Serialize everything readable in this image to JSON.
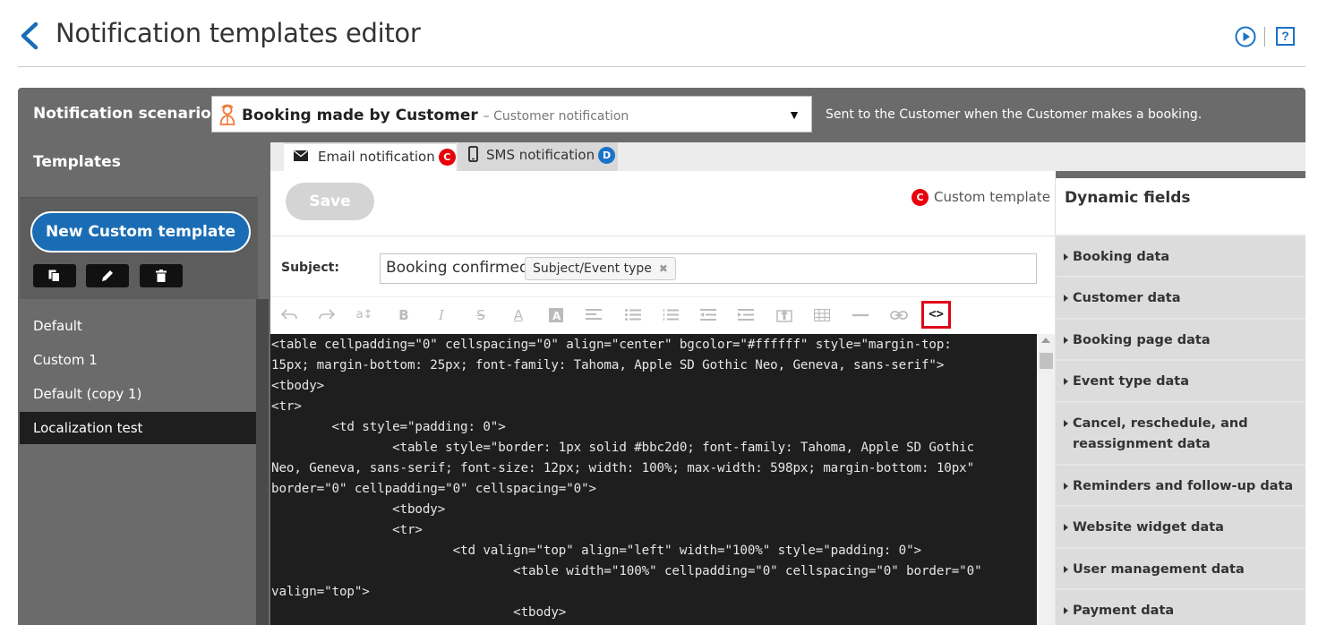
{
  "header": {
    "title": "Notification templates editor",
    "help_label": "?"
  },
  "scenario": {
    "label": "Notification scenario:",
    "selected_main": "Booking made by Customer",
    "selected_sub": "– Customer notification",
    "description": "Sent to the Customer when the Customer makes a booking."
  },
  "sidebar": {
    "title": "Templates",
    "new_button": "New Custom template",
    "items": [
      {
        "label": "Default",
        "active": false
      },
      {
        "label": "Custom 1",
        "active": false
      },
      {
        "label": "Default (copy 1)",
        "active": false
      },
      {
        "label": "Localization test",
        "active": true
      }
    ]
  },
  "tabs": [
    {
      "label": "Email notification",
      "badge": "C",
      "active": true
    },
    {
      "label": "SMS notification",
      "badge": "D",
      "active": false
    }
  ],
  "editor": {
    "save_label": "Save",
    "custom_badge": "C",
    "custom_label": "Custom template",
    "subject_label": "Subject:",
    "subject_text": "Booking confirmed:",
    "subject_tag": "Subject/Event type",
    "source_button": "<>",
    "code_lines": [
      "<table cellpadding=\"0\" cellspacing=\"0\" align=\"center\" bgcolor=\"#ffffff\" style=\"margin-top:",
      "15px; margin-bottom: 25px; font-family: Tahoma, Apple SD Gothic Neo, Geneva, sans-serif\">",
      "<tbody>",
      "<tr>",
      "        <td style=\"padding: 0\">",
      "                <table style=\"border: 1px solid #bbc2d0; font-family: Tahoma, Apple SD Gothic",
      "Neo, Geneva, sans-serif; font-size: 12px; width: 100%; max-width: 598px; margin-bottom: 10px\"",
      "border=\"0\" cellpadding=\"0\" cellspacing=\"0\">",
      "                <tbody>",
      "                <tr>",
      "                        <td valign=\"top\" align=\"left\" width=\"100%\" style=\"padding: 0\">",
      "                                <table width=\"100%\" cellpadding=\"0\" cellspacing=\"0\" border=\"0\"",
      "valign=\"top\">",
      "                                <tbody>"
    ]
  },
  "dynamic_fields": {
    "title": "Dynamic fields",
    "items": [
      "Booking data",
      "Customer data",
      "Booking page data",
      "Event type data",
      "Cancel, reschedule, and reassignment data",
      "Reminders and follow-up data",
      "Website widget data",
      "User management data",
      "Payment data"
    ]
  },
  "colors": {
    "accent": "#1a6db5",
    "badge_custom": "#e8000b",
    "badge_default": "#1a73c8",
    "frame": "#6b6b6b",
    "code_bg": "#1e1e1e"
  },
  "icons": {
    "back": "chevron-left-icon",
    "play": "play-circle-icon",
    "help": "help-icon",
    "person": "person-icon",
    "email": "envelope-icon",
    "sms": "phone-icon"
  }
}
